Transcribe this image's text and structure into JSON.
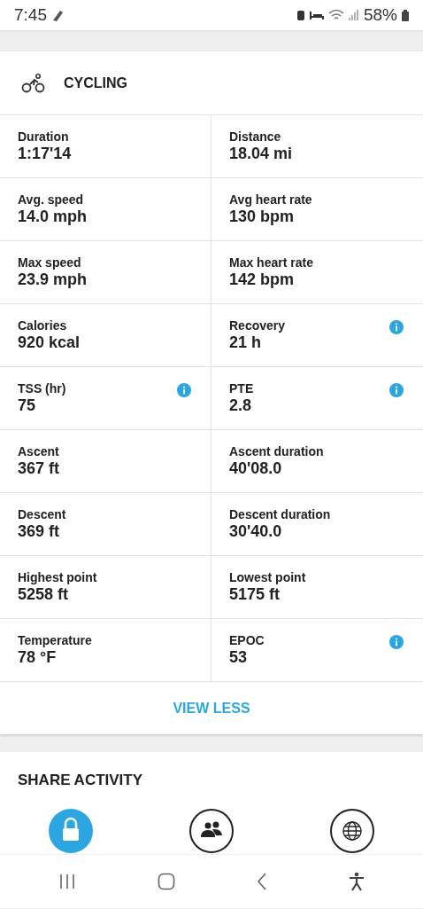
{
  "status_bar": {
    "time": "7:45",
    "battery": "58%"
  },
  "activity": {
    "title": "CYCLING",
    "stats": [
      {
        "label": "Duration",
        "value": "1:17'14",
        "info": false
      },
      {
        "label": "Distance",
        "value": "18.04 mi",
        "info": false
      },
      {
        "label": "Avg. speed",
        "value": "14.0 mph",
        "info": false
      },
      {
        "label": "Avg heart rate",
        "value": "130 bpm",
        "info": false
      },
      {
        "label": "Max speed",
        "value": "23.9 mph",
        "info": false
      },
      {
        "label": "Max heart rate",
        "value": "142 bpm",
        "info": false
      },
      {
        "label": "Calories",
        "value": "920 kcal",
        "info": false
      },
      {
        "label": "Recovery",
        "value": "21 h",
        "info": true
      },
      {
        "label": "TSS (hr)",
        "value": "75",
        "info": true
      },
      {
        "label": "PTE",
        "value": "2.8",
        "info": true
      },
      {
        "label": "Ascent",
        "value": "367 ft",
        "info": false
      },
      {
        "label": "Ascent duration",
        "value": "40'08.0",
        "info": false
      },
      {
        "label": "Descent",
        "value": "369 ft",
        "info": false
      },
      {
        "label": "Descent duration",
        "value": "30'40.0",
        "info": false
      },
      {
        "label": "Highest point",
        "value": "5258 ft",
        "info": false
      },
      {
        "label": "Lowest point",
        "value": "5175 ft",
        "info": false
      },
      {
        "label": "Temperature",
        "value": "78 °F",
        "info": false
      },
      {
        "label": "EPOC",
        "value": "53",
        "info": true
      }
    ],
    "toggle": "VIEW LESS"
  },
  "share": {
    "title": "SHARE ACTIVITY",
    "options": [
      {
        "kind": "private",
        "selected": true
      },
      {
        "kind": "friends",
        "selected": false
      },
      {
        "kind": "public",
        "selected": false
      }
    ]
  }
}
